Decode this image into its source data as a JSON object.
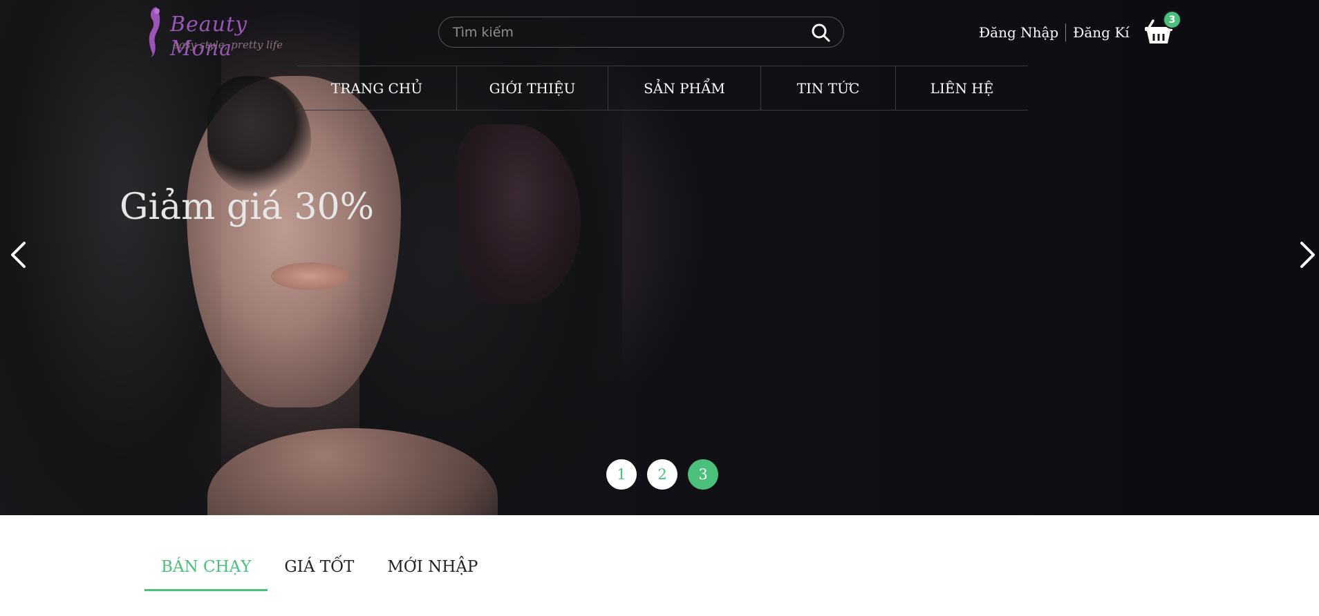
{
  "brand": {
    "name": "Beauty Mona",
    "tagline": "easy style, pretty life"
  },
  "search": {
    "placeholder": "Tìm kiếm",
    "icon": "search-icon"
  },
  "auth": {
    "login_label": "Đăng Nhập",
    "register_label": "Đăng Kí"
  },
  "cart": {
    "icon": "basket-icon",
    "count": "3"
  },
  "nav": {
    "items": [
      {
        "label": "TRANG CHỦ"
      },
      {
        "label": "GIỚI THIỆU"
      },
      {
        "label": "SẢN PHẨM"
      },
      {
        "label": "TIN TỨC"
      },
      {
        "label": "LIÊN HỆ"
      }
    ]
  },
  "slider": {
    "caption": "Giảm giá 30%",
    "prev_icon": "chevron-left-icon",
    "next_icon": "chevron-right-icon",
    "pages": [
      "1",
      "2",
      "3"
    ],
    "active_page": "3"
  },
  "product_tabs": {
    "items": [
      {
        "label": "BÁN CHẠY"
      },
      {
        "label": "GIÁ TỐT"
      },
      {
        "label": "MỚI NHẬP"
      }
    ],
    "active": "BÁN CHẠY"
  },
  "colors": {
    "accent": "#4ac07a",
    "brand_purple": "#9b55b8"
  }
}
